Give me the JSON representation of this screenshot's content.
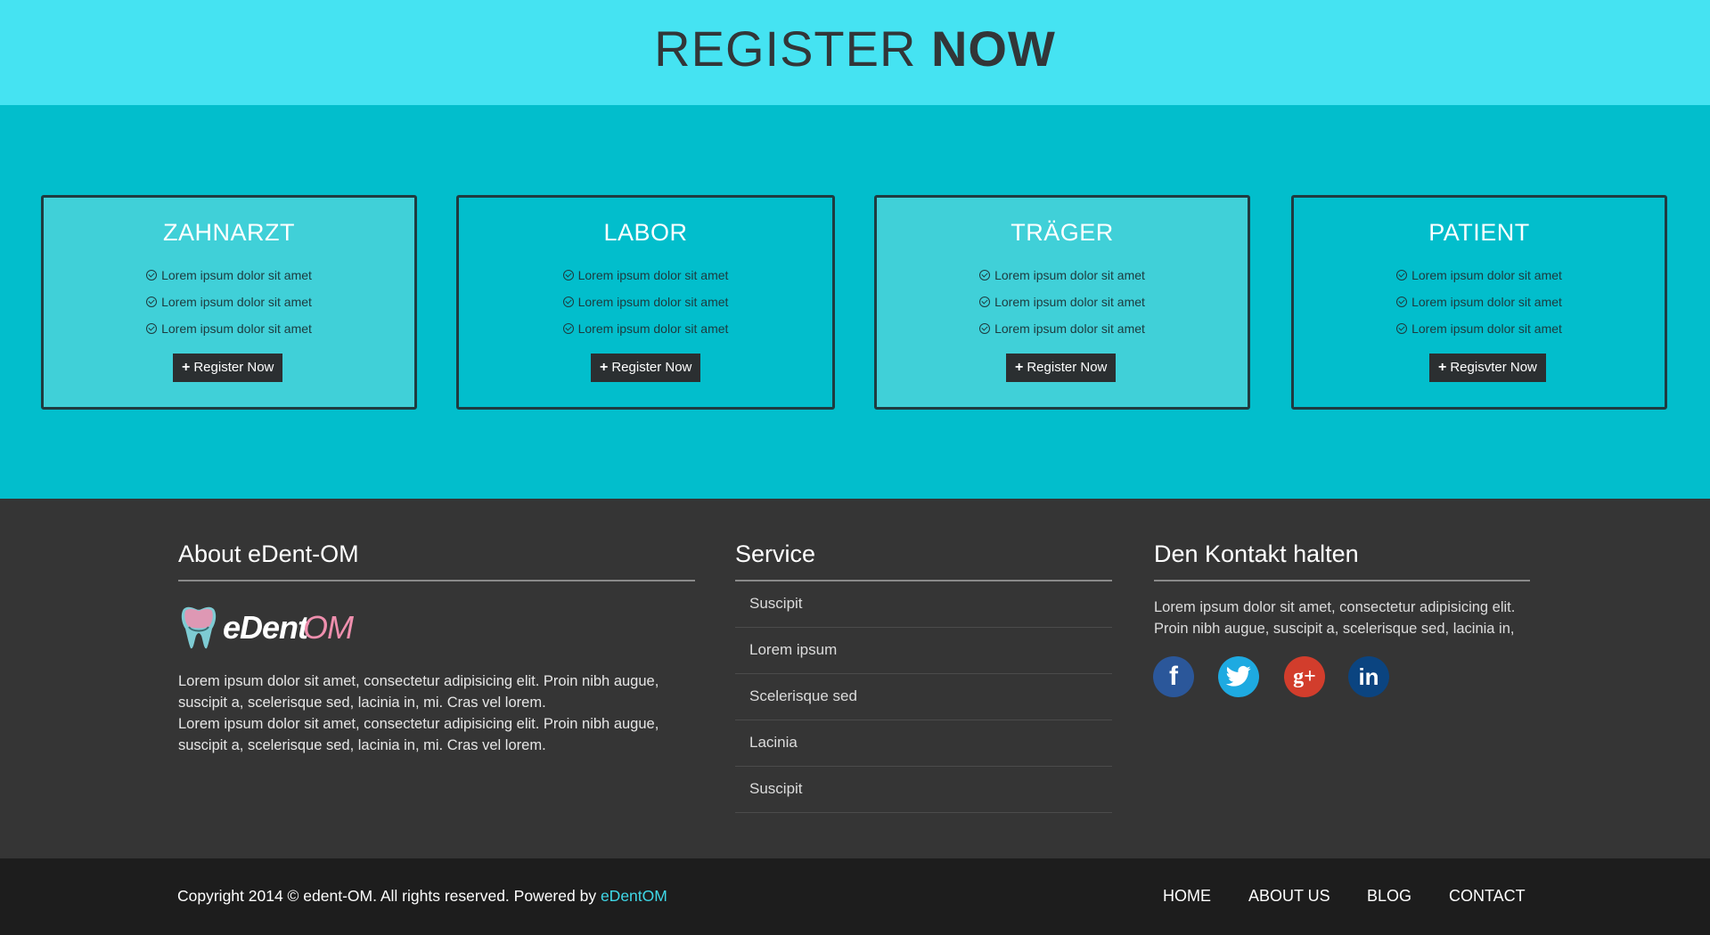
{
  "hero": {
    "title_thin": "REGISTER",
    "title_bold": "NOW"
  },
  "cards": [
    {
      "title": "ZAHNARZT",
      "items": [
        "Lorem ipsum dolor sit amet",
        "Lorem ipsum dolor sit amet",
        "Lorem ipsum dolor sit amet"
      ],
      "button": "Register Now"
    },
    {
      "title": "LABOR",
      "items": [
        "Lorem ipsum dolor sit amet",
        "Lorem ipsum dolor sit amet",
        "Lorem ipsum dolor sit amet"
      ],
      "button": "Register Now"
    },
    {
      "title": "TRÄGER",
      "items": [
        "Lorem ipsum dolor sit amet",
        "Lorem ipsum dolor sit amet",
        "Lorem ipsum dolor sit amet"
      ],
      "button": "Register Now"
    },
    {
      "title": "PATIENT",
      "items": [
        "Lorem ipsum dolor sit amet",
        "Lorem ipsum dolor sit amet",
        "Lorem ipsum dolor sit amet"
      ],
      "button": "Regisvter Now"
    }
  ],
  "footer": {
    "about": {
      "title": "About eDent-OM",
      "logo_text_bold": "eDent",
      "logo_text_light": "OM",
      "paragraph_1": "Lorem ipsum dolor sit amet, consectetur adipisicing elit. Proin nibh augue, suscipit a, scelerisque sed, lacinia in, mi. Cras vel lorem.",
      "paragraph_2": "Lorem ipsum dolor sit amet, consectetur adipisicing elit. Proin nibh augue, suscipit a, scelerisque sed, lacinia in, mi. Cras vel lorem."
    },
    "service": {
      "title": "Service",
      "items": [
        "Suscipit",
        "Lorem ipsum",
        "Scelerisque sed",
        "Lacinia",
        "Suscipit"
      ]
    },
    "contact": {
      "title": "Den Kontakt halten",
      "text": "Lorem ipsum dolor sit amet, consectetur adipisicing elit. Proin nibh augue, suscipit a, scelerisque sed, lacinia in,",
      "social": [
        {
          "icon": "facebook-icon",
          "glyph": "f",
          "color": "#2b579a"
        },
        {
          "icon": "twitter-icon",
          "glyph": "t",
          "color": "#1eaae1"
        },
        {
          "icon": "google-plus-icon",
          "glyph": "g+",
          "color": "#d23d2c"
        },
        {
          "icon": "linkedin-icon",
          "glyph": "in",
          "color": "#0b4480"
        }
      ]
    }
  },
  "bottom_bar": {
    "copyright_prefix": "Copyright 2014 © edent-OM. All rights reserved. Powered by",
    "copyright_brand": "eDentOM",
    "nav": [
      "HOME",
      "ABOUT US",
      "BLOG",
      "CONTACT"
    ]
  },
  "colors": {
    "hero_bg": "#45e3f2",
    "section_bg": "#02becc",
    "card_light_bg": "#40d0d8",
    "footer_bg": "#353535",
    "bottom_bg": "#1d1d1d",
    "accent": "#3fd8e8"
  }
}
